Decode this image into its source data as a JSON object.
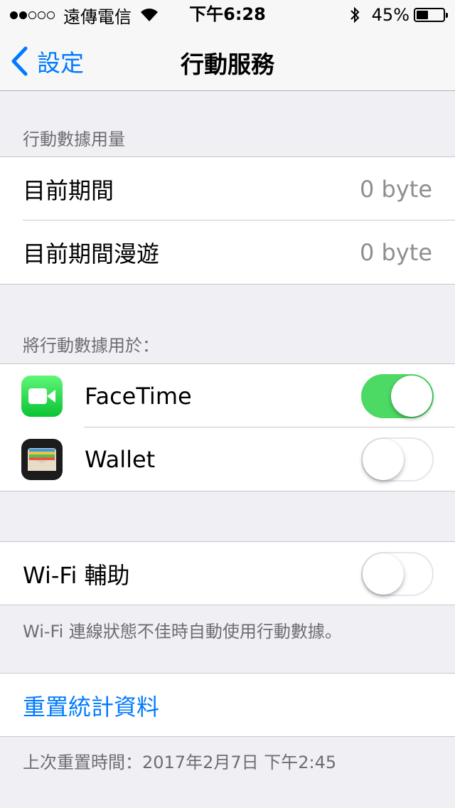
{
  "status_bar": {
    "carrier": "遠傳電信",
    "time": "下午6:28",
    "battery": "45%",
    "battery_level": 0.45,
    "signal_strength": 2
  },
  "nav": {
    "back_label": "設定",
    "title": "行動服務"
  },
  "usage_section": {
    "header": "行動數據用量",
    "rows": [
      {
        "label": "目前期間",
        "value": "0 byte"
      },
      {
        "label": "目前期間漫遊",
        "value": "0 byte"
      }
    ]
  },
  "apps_section": {
    "header": "將行動數據用於：",
    "apps": [
      {
        "name": "FaceTime",
        "icon": "facetime-icon",
        "enabled": true
      },
      {
        "name": "Wallet",
        "icon": "wallet-icon",
        "enabled": false
      }
    ]
  },
  "wifi_assist": {
    "label": "Wi-Fi 輔助",
    "enabled": false,
    "footer": "Wi-Fi 連線狀態不佳時自動使用行動數據。"
  },
  "reset": {
    "label": "重置統計資料",
    "footer": "上次重置時間：2017年2月7日 下午2:45"
  },
  "colors": {
    "accent": "#007aff",
    "toggle_on": "#4cd964",
    "background": "#efeff4"
  }
}
